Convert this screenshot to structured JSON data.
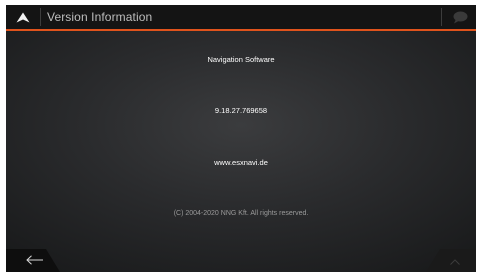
{
  "header": {
    "title": "Version Information"
  },
  "content": {
    "software_label": "Navigation Software",
    "version": "9.18.27.769658",
    "website": "www.esxnavi.de",
    "copyright": "(C) 2004-2020 NNG Kft. All rights reserved."
  },
  "icons": {
    "up": "triangle-up-icon",
    "chat": "speech-bubble-icon",
    "back": "arrow-left-icon",
    "scroll_up": "chevron-up-icon"
  },
  "colors": {
    "accent": "#e0531c",
    "header_bg": "#141414",
    "text": "#ffffff",
    "muted_text": "#9a9a9a"
  }
}
